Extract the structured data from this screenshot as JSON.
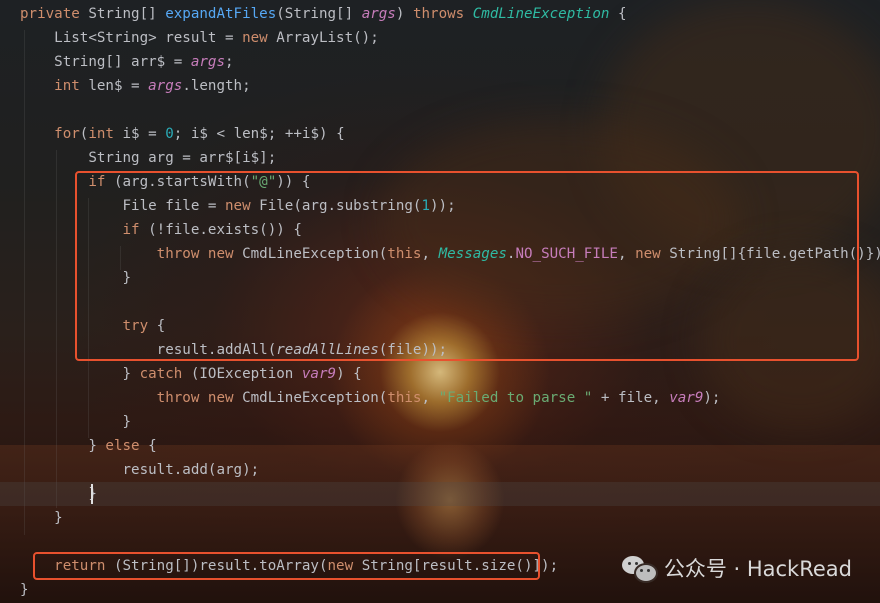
{
  "editor": {
    "lines": [
      [
        {
          "t": "private ",
          "c": "kw"
        },
        {
          "t": "String[] "
        },
        {
          "t": "expandAtFiles",
          "c": "fn"
        },
        {
          "t": "(String[] "
        },
        {
          "t": "args",
          "c": "par"
        },
        {
          "t": ") "
        },
        {
          "t": "throws ",
          "c": "kw"
        },
        {
          "t": "CmdLineException",
          "c": "ex"
        },
        {
          "t": " {"
        }
      ],
      [
        {
          "t": "    List<String> result = "
        },
        {
          "t": "new ",
          "c": "kw"
        },
        {
          "t": "ArrayList();"
        }
      ],
      [
        {
          "t": "    String[] arr$ = "
        },
        {
          "t": "args",
          "c": "par"
        },
        {
          "t": ";"
        }
      ],
      [
        {
          "t": "    "
        },
        {
          "t": "int ",
          "c": "kw"
        },
        {
          "t": "len$ = "
        },
        {
          "t": "args",
          "c": "par"
        },
        {
          "t": ".length;"
        }
      ],
      [
        {
          "t": ""
        }
      ],
      [
        {
          "t": "    "
        },
        {
          "t": "for",
          "c": "kw"
        },
        {
          "t": "("
        },
        {
          "t": "int ",
          "c": "kw"
        },
        {
          "t": "i$ = "
        },
        {
          "t": "0",
          "c": "num"
        },
        {
          "t": "; i$ < len$; ++i$) {"
        }
      ],
      [
        {
          "t": "        String arg = arr$[i$];"
        }
      ],
      [
        {
          "t": "        "
        },
        {
          "t": "if ",
          "c": "kw"
        },
        {
          "t": "(arg.startsWith("
        },
        {
          "t": "\"@\"",
          "c": "str"
        },
        {
          "t": ")) {"
        }
      ],
      [
        {
          "t": "            File file = "
        },
        {
          "t": "new ",
          "c": "kw"
        },
        {
          "t": "File(arg.substring("
        },
        {
          "t": "1",
          "c": "num"
        },
        {
          "t": "));"
        }
      ],
      [
        {
          "t": "            "
        },
        {
          "t": "if ",
          "c": "kw"
        },
        {
          "t": "(!file.exists()) {"
        }
      ],
      [
        {
          "t": "                "
        },
        {
          "t": "throw new ",
          "c": "kw"
        },
        {
          "t": "CmdLineException(",
          "c": ""
        },
        {
          "t": "this",
          "c": "kw"
        },
        {
          "t": ", "
        },
        {
          "t": "Messages",
          "c": "ex"
        },
        {
          "t": "."
        },
        {
          "t": "NO_SUCH_FILE",
          "c": "cnst"
        },
        {
          "t": ", "
        },
        {
          "t": "new ",
          "c": "kw"
        },
        {
          "t": "String[]{file.getPath()});"
        }
      ],
      [
        {
          "t": "            }"
        }
      ],
      [
        {
          "t": ""
        }
      ],
      [
        {
          "t": "            "
        },
        {
          "t": "try ",
          "c": "kw"
        },
        {
          "t": "{"
        }
      ],
      [
        {
          "t": "                result.addAll("
        },
        {
          "t": "readAllLines",
          "c": "ital"
        },
        {
          "t": "(file));"
        }
      ],
      [
        {
          "t": "            } "
        },
        {
          "t": "catch ",
          "c": "kw"
        },
        {
          "t": "(IOException "
        },
        {
          "t": "var9",
          "c": "par"
        },
        {
          "t": ") {"
        }
      ],
      [
        {
          "t": "                "
        },
        {
          "t": "throw new ",
          "c": "kw"
        },
        {
          "t": "CmdLineException("
        },
        {
          "t": "this",
          "c": "kw"
        },
        {
          "t": ", "
        },
        {
          "t": "\"Failed to parse \"",
          "c": "str"
        },
        {
          "t": " + file, "
        },
        {
          "t": "var9",
          "c": "par"
        },
        {
          "t": ");"
        }
      ],
      [
        {
          "t": "            }"
        }
      ],
      [
        {
          "t": "        } "
        },
        {
          "t": "else ",
          "c": "kw"
        },
        {
          "t": "{"
        }
      ],
      [
        {
          "t": "            result.add(arg);"
        }
      ],
      [
        {
          "t": "        }"
        }
      ],
      [
        {
          "t": "    }"
        }
      ],
      [
        {
          "t": ""
        }
      ],
      [
        {
          "t": "    "
        },
        {
          "t": "return ",
          "c": "kw"
        },
        {
          "t": "(String[])result.toArray("
        },
        {
          "t": "new ",
          "c": "kw"
        },
        {
          "t": "String[result.size()]);"
        }
      ],
      [
        {
          "t": "}"
        }
      ]
    ],
    "highlight_color": "#e8512e",
    "highlighted_line_groups": [
      "lines 8-15",
      "line 24"
    ]
  },
  "watermark": {
    "icon": "wechat-icon",
    "text": "公众号 · HackRead"
  }
}
